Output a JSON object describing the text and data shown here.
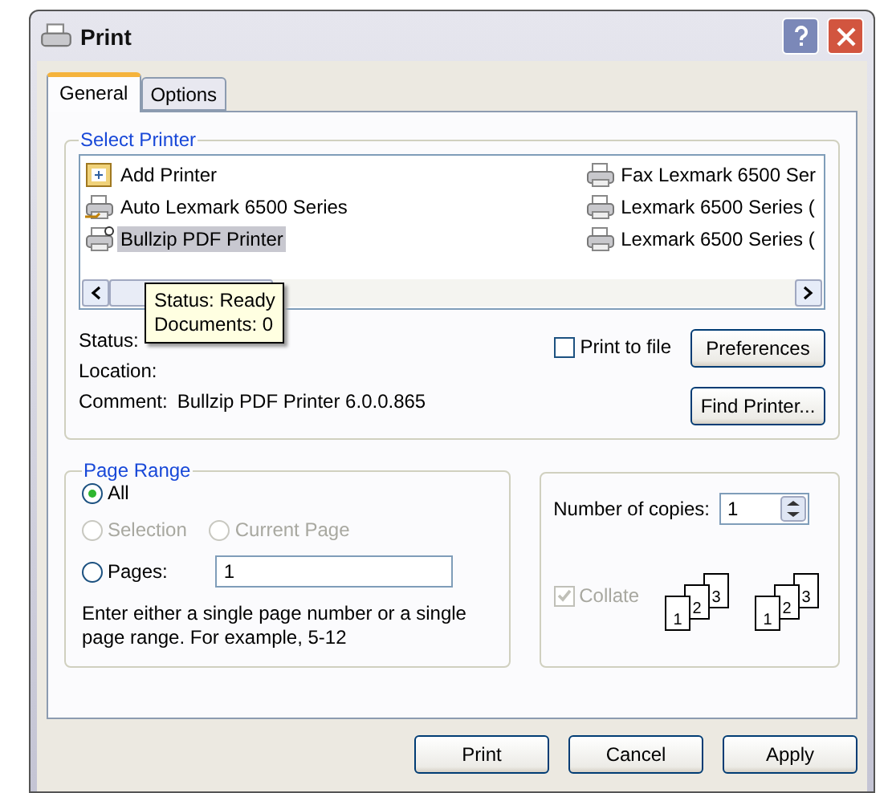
{
  "window": {
    "title": "Print"
  },
  "tabs": [
    {
      "label": "General",
      "selected": true
    },
    {
      "label": "Options",
      "selected": false
    }
  ],
  "select_printer": {
    "title": "Select Printer",
    "printers": [
      {
        "name": "Add Printer",
        "kind": "add",
        "selected": false
      },
      {
        "name": "Auto Lexmark 6500 Series",
        "kind": "shared",
        "selected": false
      },
      {
        "name": "Bullzip PDF Printer",
        "kind": "default",
        "selected": true
      },
      {
        "name": "Fax Lexmark 6500 Ser",
        "kind": "printer",
        "selected": false
      },
      {
        "name": "Lexmark 6500 Series (",
        "kind": "printer",
        "selected": false
      },
      {
        "name": "Lexmark 6500 Series (",
        "kind": "printer",
        "selected": false
      }
    ],
    "tooltip": [
      "Status: Ready",
      "Documents: 0"
    ],
    "status_label": "Status:",
    "location_label": "Location:",
    "comment_label": "Comment:",
    "comment": "Bullzip PDF Printer 6.0.0.865",
    "print_to_file": {
      "label": "Print to file",
      "checked": false
    },
    "buttons": [
      "Preferences",
      "Find Printer..."
    ]
  },
  "page_range": {
    "title": "Page Range",
    "options": [
      {
        "label": "All",
        "selected": true,
        "disabled": false
      },
      {
        "label": "Selection",
        "selected": false,
        "disabled": true
      },
      {
        "label": "Current Page",
        "selected": false,
        "disabled": true
      },
      {
        "label": "Pages:",
        "selected": false,
        "disabled": false
      }
    ],
    "pages_value": "1",
    "hint": "Enter either a single page number or a single page range.  For example, 5-12"
  },
  "copies": {
    "label": "Number of copies:",
    "value": "1",
    "collate": {
      "label": "Collate",
      "checked": true,
      "disabled": true
    },
    "stacks": [
      [
        "1",
        "2",
        "3"
      ],
      [
        "1",
        "2",
        "3"
      ]
    ]
  },
  "buttons": [
    "Print",
    "Cancel",
    "Apply"
  ]
}
